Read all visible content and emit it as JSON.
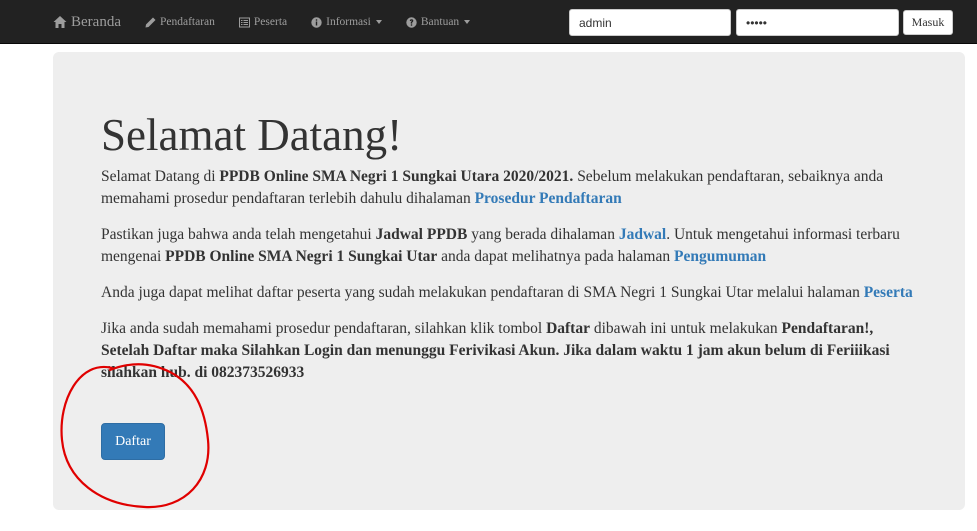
{
  "navbar": {
    "brand": "Beranda",
    "items": [
      {
        "label": "Pendaftaran",
        "icon": "pencil-icon",
        "dropdown": false
      },
      {
        "label": "Peserta",
        "icon": "list-icon",
        "dropdown": false
      },
      {
        "label": "Informasi",
        "icon": "info-circle-icon",
        "dropdown": true
      },
      {
        "label": "Bantuan",
        "icon": "question-circle-icon",
        "dropdown": true
      }
    ],
    "username_value": "admin",
    "password_value": "•••••",
    "login_label": "Masuk"
  },
  "jumbotron": {
    "title": "Selamat Datang!",
    "p1": {
      "t1": "Selamat Datang di ",
      "b1": "PPDB Online SMA Negri 1 Sungkai Utara 2020/2021.",
      "t2": " Sebelum melakukan pendaftaran, sebaiknya anda memahami prosedur pendaftaran terlebih dahulu dihalaman ",
      "link": "Prosedur Pendaftaran"
    },
    "p2": {
      "t1": "Pastikan juga bahwa anda telah mengetahui ",
      "b1": "Jadwal PPDB",
      "t2": " yang berada dihalaman ",
      "link1": "Jadwal",
      "t3": ". Untuk mengetahui informasi terbaru mengenai ",
      "b2": "PPDB Online SMA Negri 1 Sungkai Utar",
      "t4": " anda dapat melihatnya pada halaman ",
      "link2": "Pengumuman"
    },
    "p3": {
      "t1": "Anda juga dapat melihat daftar peserta yang sudah melakukan pendaftaran di SMA Negri 1 Sungkai Utar melalui halaman ",
      "link": "Peserta"
    },
    "p4": {
      "t1": "Jika anda sudah memahami prosedur pendaftaran, silahkan klik tombol ",
      "b1": "Daftar",
      "t2": " dibawah ini untuk melakukan ",
      "b2": "Pendaftaran!, Setelah Daftar maka Silahkan Login dan menunggu Ferivikasi Akun. Jika dalam waktu 1 jam akun belum di Feriiikasi silahkan hub. di 082373526933"
    },
    "button_label": "Daftar"
  },
  "colors": {
    "navbar_bg": "#222222",
    "nav_text": "#9d9d9d",
    "jumbotron_bg": "#eeeeee",
    "link": "#337ab7",
    "primary_button": "#337ab7",
    "annotation": "#e00000"
  }
}
